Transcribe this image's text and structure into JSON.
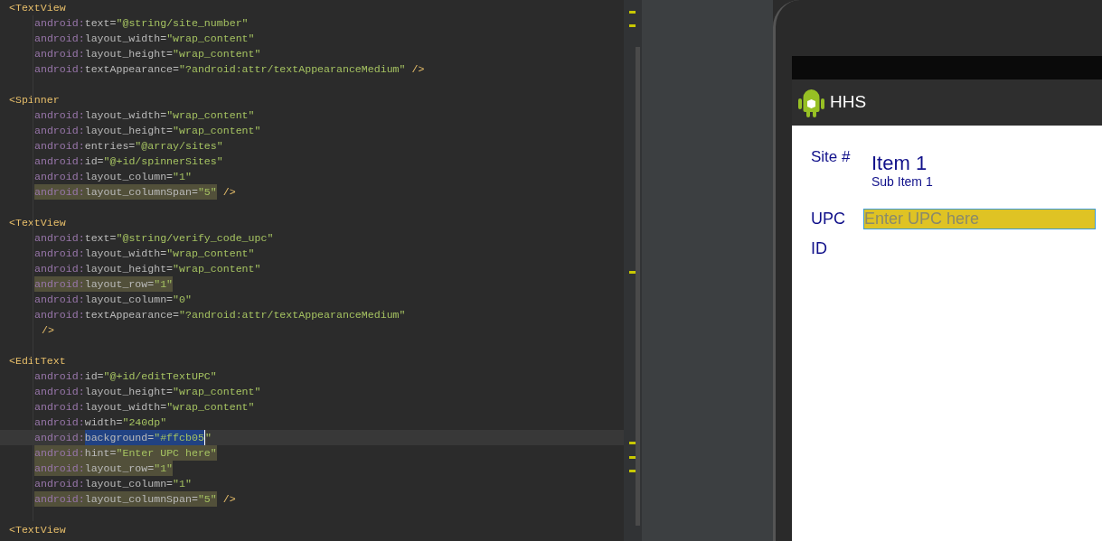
{
  "editor": {
    "lines": [
      {
        "kind": "tag",
        "text": "<TextView"
      },
      {
        "kind": "attr",
        "ns": "android:",
        "name": "text=",
        "value": "\"@string/site_number\"",
        "highlighted": false,
        "current": false
      },
      {
        "kind": "attr",
        "ns": "android:",
        "name": "layout_width=",
        "value": "\"wrap_content\"",
        "highlighted": false,
        "current": false
      },
      {
        "kind": "attr",
        "ns": "android:",
        "name": "layout_height=",
        "value": "\"wrap_content\"",
        "highlighted": false,
        "current": false
      },
      {
        "kind": "attr",
        "ns": "android:",
        "name": "textAppearance=",
        "value": "\"?android:attr/textAppearanceMedium\"",
        "tail": "/>",
        "highlighted": false,
        "current": false
      },
      {
        "kind": "blank"
      },
      {
        "kind": "tag",
        "text": "<Spinner"
      },
      {
        "kind": "attr",
        "ns": "android:",
        "name": "layout_width=",
        "value": "\"wrap_content\"",
        "highlighted": false,
        "current": false
      },
      {
        "kind": "attr",
        "ns": "android:",
        "name": "layout_height=",
        "value": "\"wrap_content\"",
        "highlighted": false,
        "current": false
      },
      {
        "kind": "attr",
        "ns": "android:",
        "name": "entries=",
        "value": "\"@array/sites\"",
        "highlighted": false,
        "current": false
      },
      {
        "kind": "attr",
        "ns": "android:",
        "name": "id=",
        "value": "\"@+id/spinnerSites\"",
        "highlighted": false,
        "current": false
      },
      {
        "kind": "attr",
        "ns": "android:",
        "name": "layout_column=",
        "value": "\"1\"",
        "highlighted": false,
        "current": false
      },
      {
        "kind": "attr",
        "ns": "android:",
        "name": "layout_columnSpan=",
        "value": "\"5\"",
        "tail": "/>",
        "highlighted": true,
        "current": false
      },
      {
        "kind": "blank"
      },
      {
        "kind": "tag",
        "text": "<TextView"
      },
      {
        "kind": "attr",
        "ns": "android:",
        "name": "text=",
        "value": "\"@string/verify_code_upc\"",
        "highlighted": false,
        "current": false
      },
      {
        "kind": "attr",
        "ns": "android:",
        "name": "layout_width=",
        "value": "\"wrap_content\"",
        "highlighted": false,
        "current": false
      },
      {
        "kind": "attr",
        "ns": "android:",
        "name": "layout_height=",
        "value": "\"wrap_content\"",
        "highlighted": false,
        "current": false
      },
      {
        "kind": "attr",
        "ns": "android:",
        "name": "layout_row=",
        "value": "\"1\"",
        "highlighted": true,
        "current": false
      },
      {
        "kind": "attr",
        "ns": "android:",
        "name": "layout_column=",
        "value": "\"0\"",
        "highlighted": false,
        "current": false
      },
      {
        "kind": "attr",
        "ns": "android:",
        "name": "textAppearance=",
        "value": "\"?android:attr/textAppearanceMedium\"",
        "highlighted": false,
        "current": false
      },
      {
        "kind": "close",
        "text": "/>"
      },
      {
        "kind": "blank"
      },
      {
        "kind": "tag",
        "text": "<EditText"
      },
      {
        "kind": "attr",
        "ns": "android:",
        "name": "id=",
        "value": "\"@+id/editTextUPC\"",
        "highlighted": false,
        "current": false
      },
      {
        "kind": "attr",
        "ns": "android:",
        "name": "layout_height=",
        "value": "\"wrap_content\"",
        "highlighted": false,
        "current": false
      },
      {
        "kind": "attr",
        "ns": "android:",
        "name": "layout_width=",
        "value": "\"wrap_content\"",
        "highlighted": false,
        "current": false
      },
      {
        "kind": "attr",
        "ns": "android:",
        "name": "width=",
        "value": "\"240dp\"",
        "highlighted": false,
        "current": false
      },
      {
        "kind": "attr",
        "ns": "android:",
        "name": "background=",
        "value": "\"#ffcb05",
        "after": "\"",
        "selected": true,
        "highlighted": false,
        "current": true
      },
      {
        "kind": "attr",
        "ns": "android:",
        "name": "hint=",
        "value": "\"Enter UPC here\"",
        "highlighted": true,
        "current": false
      },
      {
        "kind": "attr",
        "ns": "android:",
        "name": "layout_row=",
        "value": "\"1\"",
        "highlighted": true,
        "current": false
      },
      {
        "kind": "attr",
        "ns": "android:",
        "name": "layout_column=",
        "value": "\"1\"",
        "highlighted": false,
        "current": false
      },
      {
        "kind": "attr",
        "ns": "android:",
        "name": "layout_columnSpan=",
        "value": "\"5\"",
        "tail": "/>",
        "highlighted": true,
        "current": false
      },
      {
        "kind": "blank"
      },
      {
        "kind": "tag",
        "text": "<TextView"
      }
    ]
  },
  "emulator": {
    "app_title": "HHS",
    "form": {
      "site_label": "Site #",
      "spinner_item": "Item 1",
      "spinner_sub_item": "Sub Item 1",
      "upc_label": "UPC",
      "upc_field": {
        "placeholder": "Enter UPC here"
      },
      "id_label": "ID"
    }
  }
}
